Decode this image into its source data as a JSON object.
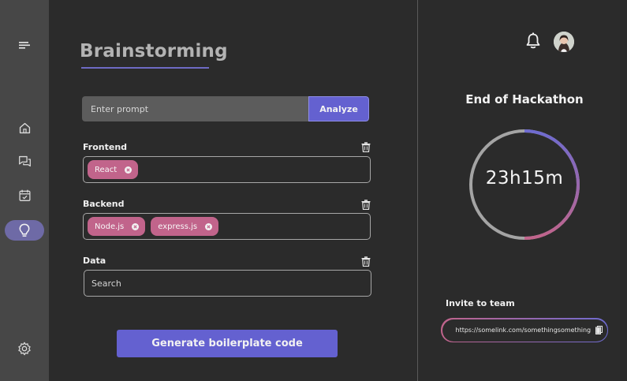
{
  "sidebar": {
    "items": [
      {
        "icon": "home-icon"
      },
      {
        "icon": "chat-icon"
      },
      {
        "icon": "calendar-icon"
      },
      {
        "icon": "lightbulb-icon",
        "active": true
      },
      {
        "icon": "gear-icon"
      }
    ]
  },
  "main": {
    "title": "Brainstorming",
    "prompt": {
      "placeholder": "Enter prompt",
      "value": "",
      "button_label": "Analyze"
    },
    "sections": [
      {
        "label": "Frontend",
        "chips": [
          "React"
        ]
      },
      {
        "label": "Backend",
        "chips": [
          "Node.js",
          "express.js"
        ]
      },
      {
        "label": "Data",
        "placeholder": "Search"
      }
    ],
    "generate_label": "Generate boilerplate code"
  },
  "right": {
    "countdown_title": "End of Hackathon",
    "countdown_value": "23h15m",
    "countdown_progress": 0.5,
    "invite_label": "Invite to team",
    "invite_link": "https://somelink.com/somethingsomething"
  },
  "colors": {
    "accent": "#6461d0",
    "chip": "#c1648b",
    "background": "#2b2b2b",
    "sidebar": "#474747"
  }
}
